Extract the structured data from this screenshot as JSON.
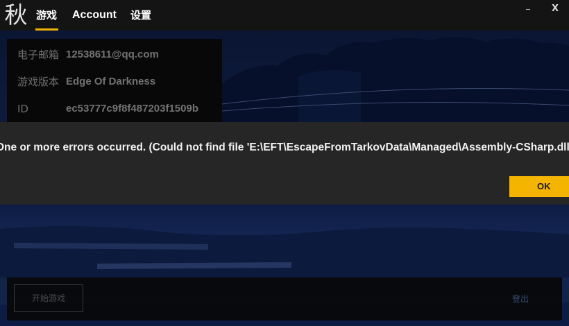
{
  "app": {
    "logo_char": "秋",
    "accent_color": "#f0b400"
  },
  "nav": {
    "tabs": [
      {
        "label": "游戏",
        "active": true
      },
      {
        "label": "Account",
        "active": false
      },
      {
        "label": "设置",
        "active": false
      }
    ]
  },
  "window_controls": {
    "minimize_icon": "minimize-icon",
    "minimize_glyph": "_",
    "close_icon": "close-icon",
    "close_glyph": "X"
  },
  "account_info": {
    "rows": [
      {
        "label": "电子邮箱",
        "value": "12538611@qq.com"
      },
      {
        "label": "游戏版本",
        "value": "Edge Of Darkness"
      },
      {
        "label": "ID",
        "value": "ec53777c9f8f487203f1509b"
      }
    ]
  },
  "bottom_bar": {
    "start_label": "开始游戏",
    "logout_label": "登出"
  },
  "dialog": {
    "message": "One or more errors occurred. (Could not find file 'E:\\EFT\\EscapeFromTarkovData\\Managed\\Assembly-CSharp.dll'.)",
    "ok_label": "OK",
    "ok_color": "#f5b400"
  }
}
